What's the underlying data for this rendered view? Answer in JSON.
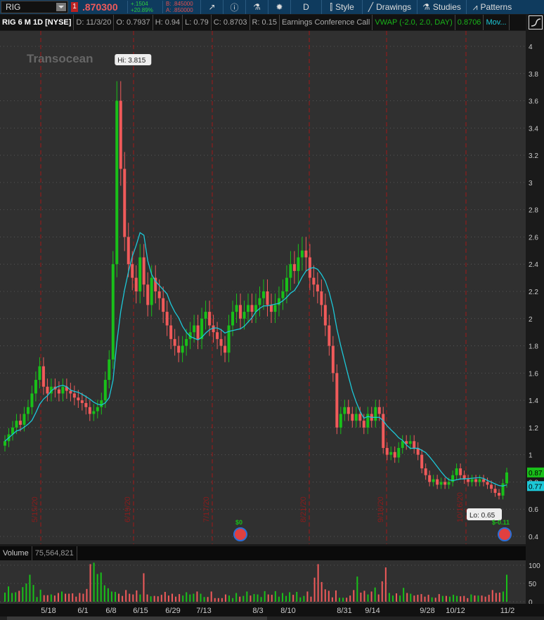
{
  "toolbar": {
    "symbol": "RIG",
    "alert_count": "1",
    "last": ".870300",
    "change": "+.1504",
    "change_pct": "+20.89%",
    "bid": "B: .845000",
    "ask": "A: .850000",
    "aggregation": "D",
    "style": "Style",
    "drawings": "Drawings",
    "studies": "Studies",
    "patterns": "Patterns"
  },
  "info": {
    "title": "RIG 6 M 1D [NYSE]",
    "date": "D: 11/3/20",
    "open": "O: 0.7937",
    "high": "H: 0.94",
    "low": "L: 0.79",
    "close": "C: 0.8703",
    "range": "R: 0.15",
    "event": "Earnings Conference Call",
    "vwap": "VWAP (-2.0, 2.0, DAY)",
    "vwap_value": "0.8706",
    "mov": "Mov..."
  },
  "volume": {
    "label": "Volume",
    "value": "75,564,821"
  },
  "logo_text": "Transocean",
  "colors": {
    "up": "#19c019",
    "down": "#f05a5a",
    "ma": "#1cc8d8",
    "bg": "#303030"
  },
  "chart_data": {
    "type": "candlestick",
    "y_ticks": [
      4,
      3.8,
      3.6,
      3.4,
      3.2,
      3,
      2.8,
      2.6,
      2.4,
      2.2,
      2,
      1.8,
      1.6,
      1.4,
      1.2,
      1,
      0.8,
      0.6,
      0.4
    ],
    "ylim": [
      0.4,
      4
    ],
    "hi_label": "Hi: 3.815",
    "lo_label": "Lo: 0.65",
    "price_tags": [
      "0.87",
      "0.77"
    ],
    "earnings": [
      {
        "label": "$0"
      },
      {
        "label": "$-0.11"
      }
    ],
    "expiry_lines": [
      "5/15/20",
      "6/19/20",
      "7/17/20",
      "8/21/20",
      "9/18/20",
      "10/16/20"
    ],
    "x_labels": [
      "5/18",
      "6/1",
      "6/8",
      "6/15",
      "6/29",
      "7/13",
      "8/3",
      "8/10",
      "8/31",
      "9/14",
      "9/28",
      "10/12",
      "11/2"
    ],
    "closes": [
      1.1,
      1.15,
      1.2,
      1.25,
      1.22,
      1.3,
      1.35,
      1.45,
      1.55,
      1.65,
      1.5,
      1.45,
      1.5,
      1.48,
      1.45,
      1.5,
      1.47,
      1.45,
      1.42,
      1.4,
      1.38,
      1.35,
      1.3,
      1.32,
      1.35,
      1.4,
      1.55,
      1.7,
      2.4,
      3.6,
      3.1,
      2.6,
      2.4,
      2.3,
      2.2,
      2.45,
      2.25,
      2.1,
      2.3,
      2.2,
      2.15,
      2.05,
      1.95,
      1.85,
      1.8,
      1.75,
      1.8,
      1.85,
      1.9,
      1.95,
      1.85,
      2.0,
      2.05,
      1.95,
      1.9,
      1.85,
      1.8,
      1.75,
      1.95,
      2.05,
      2.1,
      2.0,
      2.05,
      2.1,
      2.05,
      2.1,
      2.15,
      2.2,
      2.1,
      2.05,
      2.1,
      2.15,
      2.2,
      2.3,
      2.4,
      2.35,
      2.45,
      2.5,
      2.45,
      2.3,
      2.25,
      2.2,
      2.1,
      1.95,
      1.8,
      1.6,
      1.2,
      1.3,
      1.35,
      1.3,
      1.25,
      1.3,
      1.25,
      1.2,
      1.3,
      1.25,
      1.35,
      1.3,
      1.05,
      1.0,
      1.02,
      0.98,
      1.05,
      1.1,
      1.08,
      1.1,
      1.05,
      1.0,
      0.9,
      0.85,
      0.8,
      0.82,
      0.78,
      0.8,
      0.78,
      0.8,
      0.85,
      0.9,
      0.85,
      0.82,
      0.8,
      0.82,
      0.8,
      0.82,
      0.8,
      0.78,
      0.75,
      0.72,
      0.7,
      0.79,
      0.87
    ],
    "volume_ticks": [
      100,
      50,
      0
    ],
    "volumes": [
      25,
      42,
      24,
      26,
      30,
      40,
      50,
      74,
      46,
      13,
      33,
      18,
      18,
      20,
      17,
      24,
      28,
      22,
      22,
      23,
      14,
      24,
      22,
      35,
      103,
      107,
      76,
      80,
      45,
      37,
      28,
      27,
      22,
      16,
      32,
      22,
      20,
      31,
      20,
      78,
      20,
      15,
      16,
      15,
      19,
      27,
      17,
      22,
      14,
      21,
      17,
      26,
      20,
      22,
      28,
      22,
      13,
      13,
      28,
      10,
      10,
      10,
      20,
      17,
      10,
      24,
      14,
      16,
      28,
      17,
      21,
      20,
      13,
      29,
      20,
      19,
      29,
      14,
      24,
      16,
      26,
      19,
      27,
      12,
      16,
      28,
      14,
      66,
      103,
      54,
      34,
      30,
      12,
      31,
      11,
      11,
      11,
      17,
      32,
      69,
      25,
      30,
      20,
      28,
      39,
      20,
      56,
      94,
      24,
      17,
      23,
      17,
      38,
      24,
      22,
      17,
      19,
      21,
      14,
      19,
      12,
      11,
      21,
      16,
      16,
      14,
      19,
      16,
      15,
      16,
      10,
      20,
      17,
      17,
      17,
      14,
      19,
      32,
      24,
      25,
      28,
      74
    ]
  }
}
